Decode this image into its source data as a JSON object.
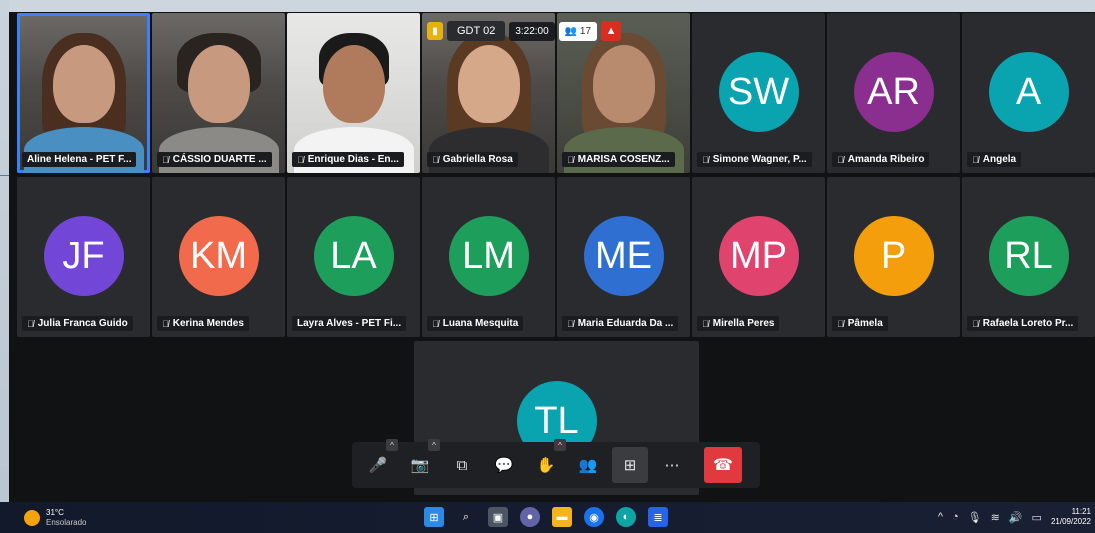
{
  "meeting": {
    "name": "GDT 02",
    "duration": "3:22:00",
    "participant_count": "17",
    "signal_icon": "signal-bars-icon",
    "alert_icon": "warning-icon"
  },
  "participants_row1": [
    {
      "name": "Aline Helena - PET F...",
      "video": true,
      "active": true
    },
    {
      "name": "CÁSSIO DUARTE ...",
      "video": true
    },
    {
      "name": "Enrique Dias - En...",
      "video": true
    },
    {
      "name": "Gabriella Rosa",
      "video": true
    },
    {
      "name": "MARISA COSENZ...",
      "video": true
    },
    {
      "name": "Simone Wagner, P...",
      "initials": "SW",
      "color": "#0aa3b0"
    },
    {
      "name": "Amanda Ribeiro",
      "initials": "AR",
      "color": "#8a2e8f"
    },
    {
      "name": "Angela",
      "initials": "A",
      "color": "#0aa3b0"
    }
  ],
  "participants_row2": [
    {
      "name": "Julia Franca Guido",
      "initials": "JF",
      "color": "#7246d6"
    },
    {
      "name": "Kerina Mendes",
      "initials": "KM",
      "color": "#f16a4b"
    },
    {
      "name": "Layra Alves - PET Fi...",
      "initials": "LA",
      "color": "#1e9e5b"
    },
    {
      "name": "Luana Mesquita",
      "initials": "LM",
      "color": "#1e9e5b"
    },
    {
      "name": "Maria Eduarda Da ...",
      "initials": "ME",
      "color": "#2f6fd1"
    },
    {
      "name": "Mirella Peres",
      "initials": "MP",
      "color": "#e0436d"
    },
    {
      "name": "Pâmela",
      "initials": "P",
      "color": "#f59e0b"
    },
    {
      "name": "Rafaela Loreto Pr...",
      "initials": "RL",
      "color": "#1e9e5b"
    }
  ],
  "participant_row3": {
    "initials": "TL",
    "color": "#0aa3b0"
  },
  "toolbar": {
    "mic": "🎤",
    "camera": "📷",
    "share": "⧉",
    "chat": "💬",
    "hand": "✋",
    "people": "👥",
    "grid": "⊞",
    "more": "⋯",
    "end": "☎"
  },
  "taskbar": {
    "temperature": "31°C",
    "weather": "Ensolarado",
    "time": "11:21",
    "date": "21/09/2022"
  }
}
